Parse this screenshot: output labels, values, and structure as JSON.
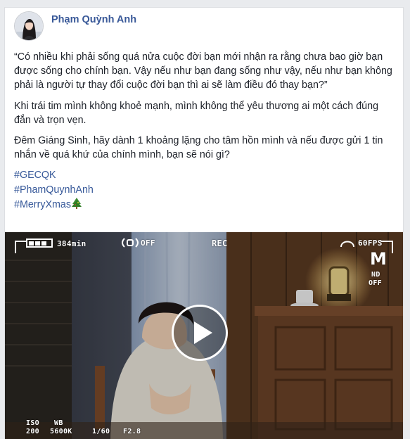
{
  "post": {
    "author": "Phạm Quỳnh Anh",
    "paragraphs": [
      "“Có nhiều khi phải sống quá nửa cuộc đời bạn mới nhận ra rằng chưa bao giờ bạn được sống cho chính bạn. Vậy nếu như bạn đang sống như vậy, nếu như bạn không phải là người tự thay đổi cuộc đời bạn thì ai sẽ làm điều đó thay bạn?”",
      "Khi trái tim mình không khoẻ mạnh, mình không thể yêu thương ai một cách đúng đắn và trọn vẹn.",
      "Đêm Giáng Sinh, hãy dành 1 khoảng lặng cho tâm hồn mình và nếu được gửi 1 tin nhắn về quá khứ của chính mình, bạn sẽ nói gì?"
    ],
    "hashtags": [
      "#GECQK",
      "#PhamQuynhAnh",
      "#MerryXmas"
    ],
    "hashtag_emoji_icon": "christmas-tree-icon"
  },
  "video": {
    "battery": "384min",
    "off_label": "OFF",
    "rec": "REC",
    "fps": "60FPS",
    "mode": "M",
    "nd": "ND",
    "nd_state": "OFF",
    "iso_label": "ISO",
    "iso_value": "200",
    "wb_label": "WB",
    "wb_value": "5600K",
    "shutter": "1/60",
    "aperture": "F2.8",
    "play_icon": "play-icon"
  },
  "colors": {
    "link": "#365899",
    "author": "#385898",
    "text": "#1d2129"
  }
}
